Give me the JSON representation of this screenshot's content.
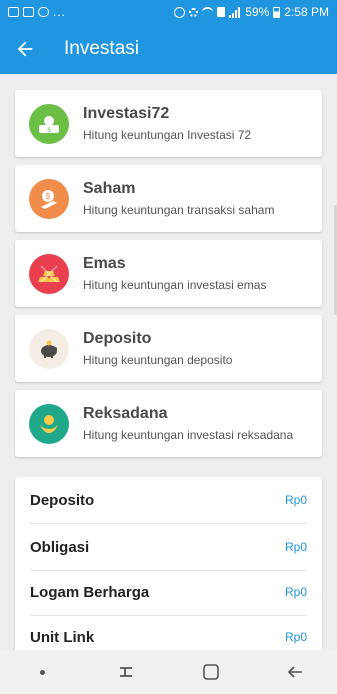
{
  "status_bar": {
    "dots": "...",
    "battery": "59%",
    "time": "2:58 PM"
  },
  "app_bar": {
    "title": "Investasi"
  },
  "menu": [
    {
      "title": "Investasi72",
      "subtitle": "Hitung keuntungan Investasi 72",
      "icon": "money-bag-icon",
      "color": "#6cbf45"
    },
    {
      "title": "Saham",
      "subtitle": "Hitung keuntungan transaksi saham",
      "icon": "stock-coin-icon",
      "color": "#f28c4b"
    },
    {
      "title": "Emas",
      "subtitle": "Hitung keuntungan investasi emas",
      "icon": "gold-bars-icon",
      "color": "#ea3f4f"
    },
    {
      "title": "Deposito",
      "subtitle": "Hitung keuntungan deposito",
      "icon": "piggy-bank-icon",
      "color": "#f3ede4"
    },
    {
      "title": "Reksadana",
      "subtitle": "Hitung keuntungan investasi reksadana",
      "icon": "coin-hand-icon",
      "color": "#21a88a"
    }
  ],
  "summary": [
    {
      "label": "Deposito",
      "value": "Rp0"
    },
    {
      "label": "Obligasi",
      "value": "Rp0"
    },
    {
      "label": "Logam Berharga",
      "value": "Rp0"
    },
    {
      "label": "Unit Link",
      "value": "Rp0"
    }
  ],
  "colors": {
    "primary": "#2196e0",
    "background": "#eeeeee"
  }
}
